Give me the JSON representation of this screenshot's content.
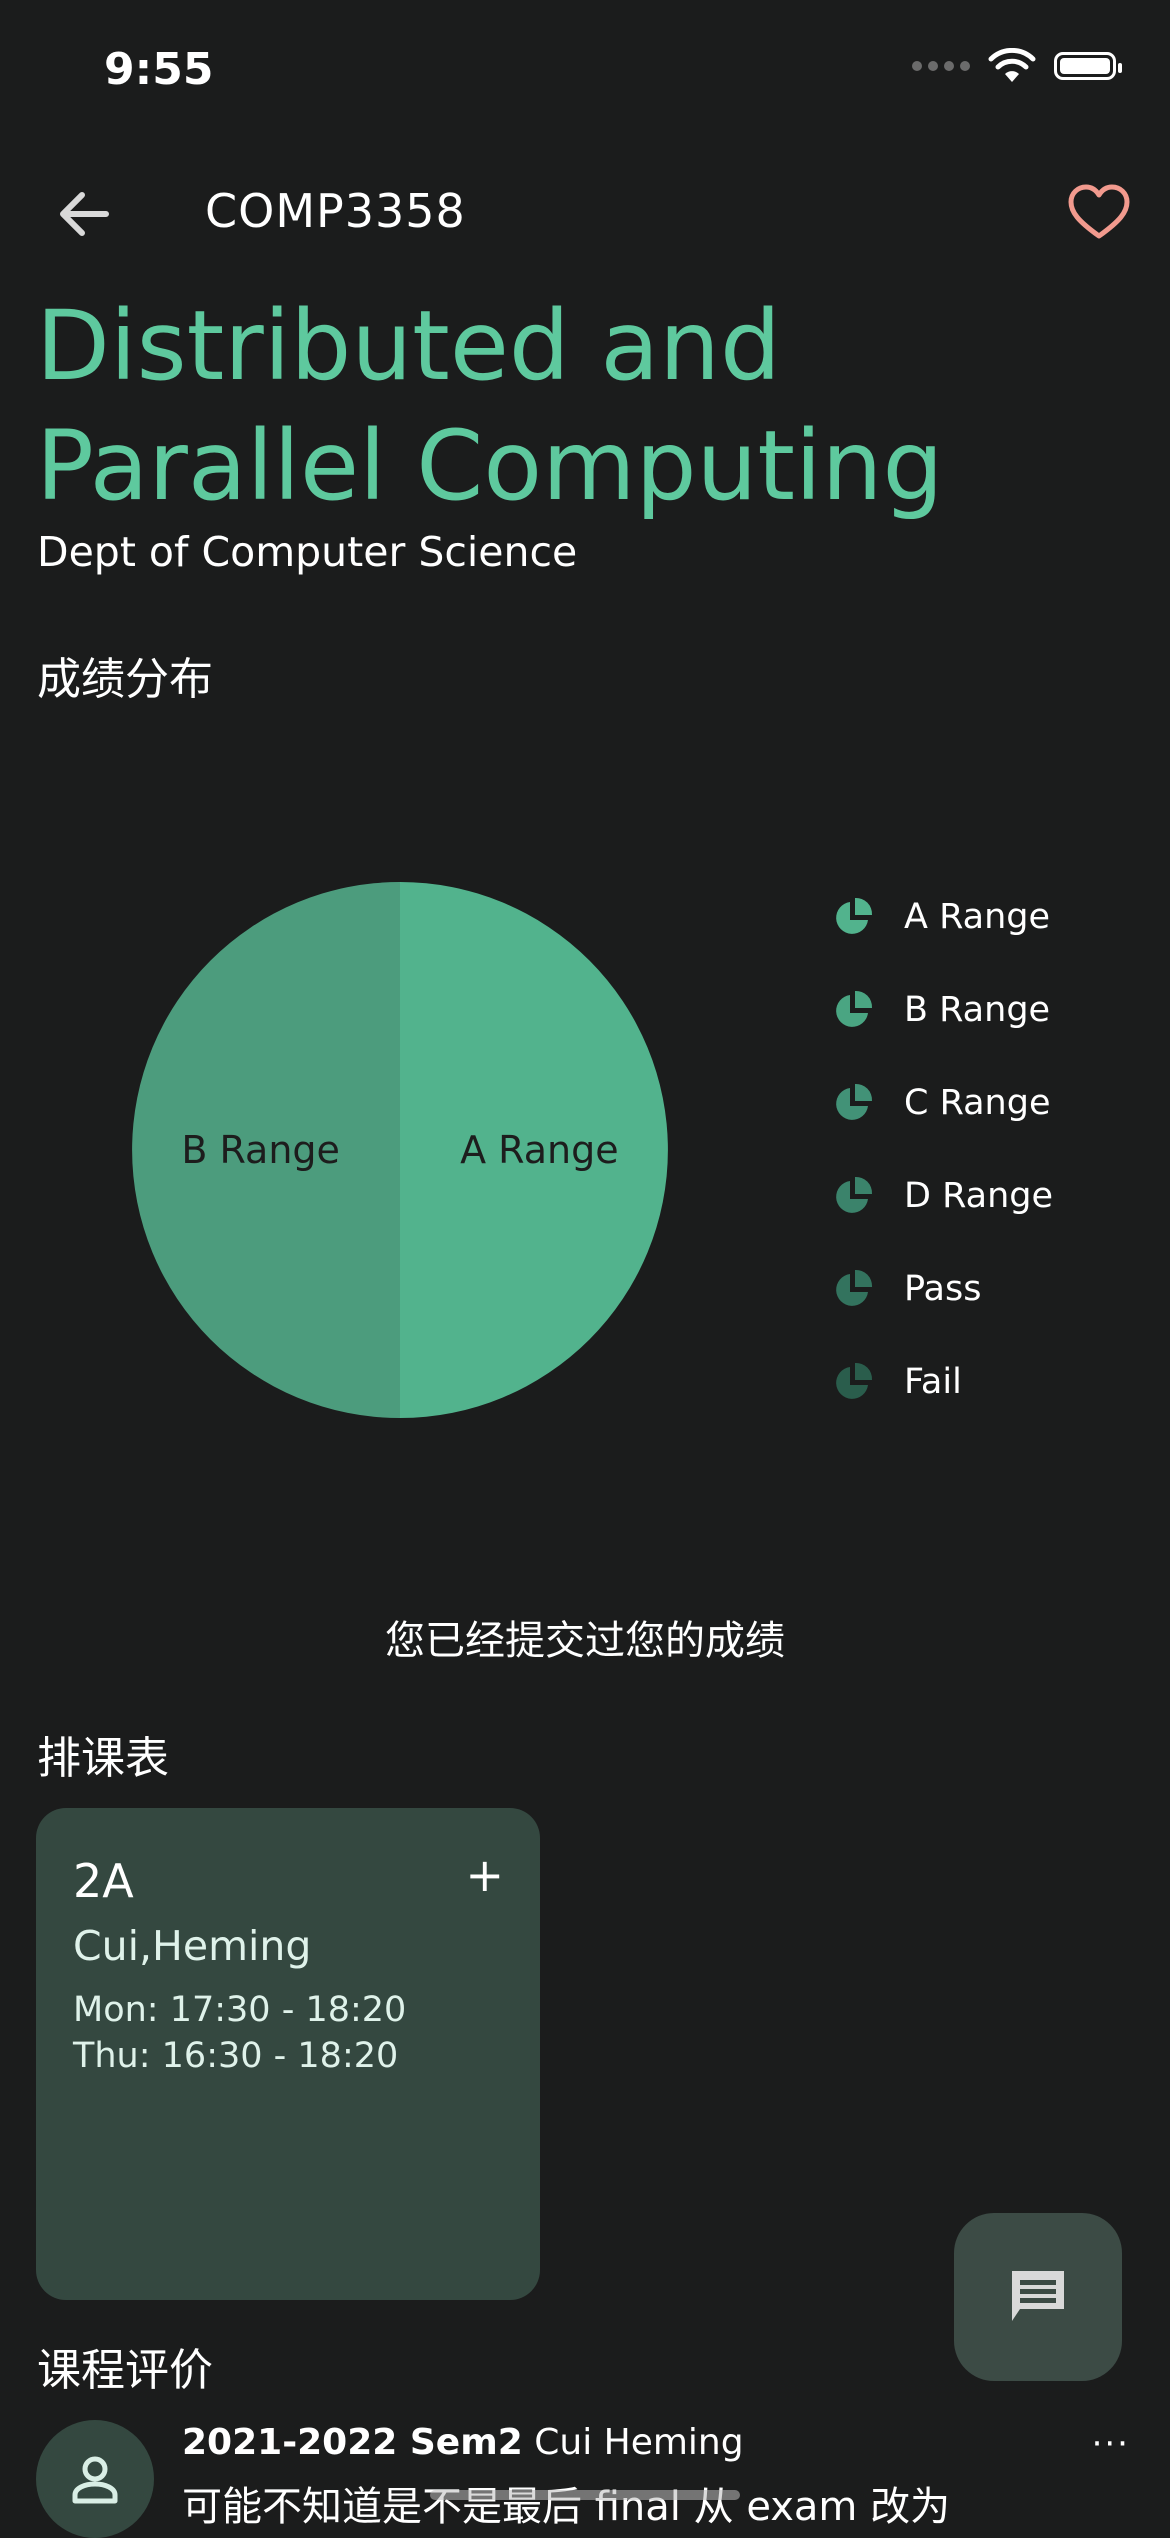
{
  "status": {
    "time": "9:55"
  },
  "header": {
    "course_code": "COMP3358"
  },
  "course": {
    "title": "Distributed and Parallel Computing",
    "department": "Dept of Computer Science"
  },
  "sections": {
    "grades": "成绩分布",
    "schedule": "排课表",
    "reviews": "课程评价"
  },
  "colors": {
    "accent": "#5ec99e",
    "favorite": "#f29a8e",
    "slice_a": "#52b38d",
    "slice_b": "#4c9c7d",
    "card_bg": "#344840",
    "background": "#1b1c1c"
  },
  "chart_data": {
    "type": "pie",
    "categories": [
      "A Range",
      "B Range",
      "C Range",
      "D Range",
      "Pass",
      "Fail"
    ],
    "values": [
      50,
      50,
      0,
      0,
      0,
      0
    ],
    "legend": [
      "A Range",
      "B Range",
      "C Range",
      "D Range",
      "Pass",
      "Fail"
    ],
    "slice_labels": [
      "A Range",
      "B Range"
    ],
    "legend_position": "right"
  },
  "grade_status": "您已经提交过您的成绩",
  "schedule": {
    "items": [
      {
        "section": "2A",
        "add_icon": "+",
        "instructor": "Cui,Heming",
        "times": [
          "Mon: 17:30 - 18:20",
          "Thu: 16:30 - 18:20"
        ]
      }
    ]
  },
  "review": {
    "term": "2021-2022 Sem2",
    "instructor": "Cui Heming",
    "text": "可能不知道是不是最后 final 从 exam 改为",
    "more_label": "···"
  }
}
